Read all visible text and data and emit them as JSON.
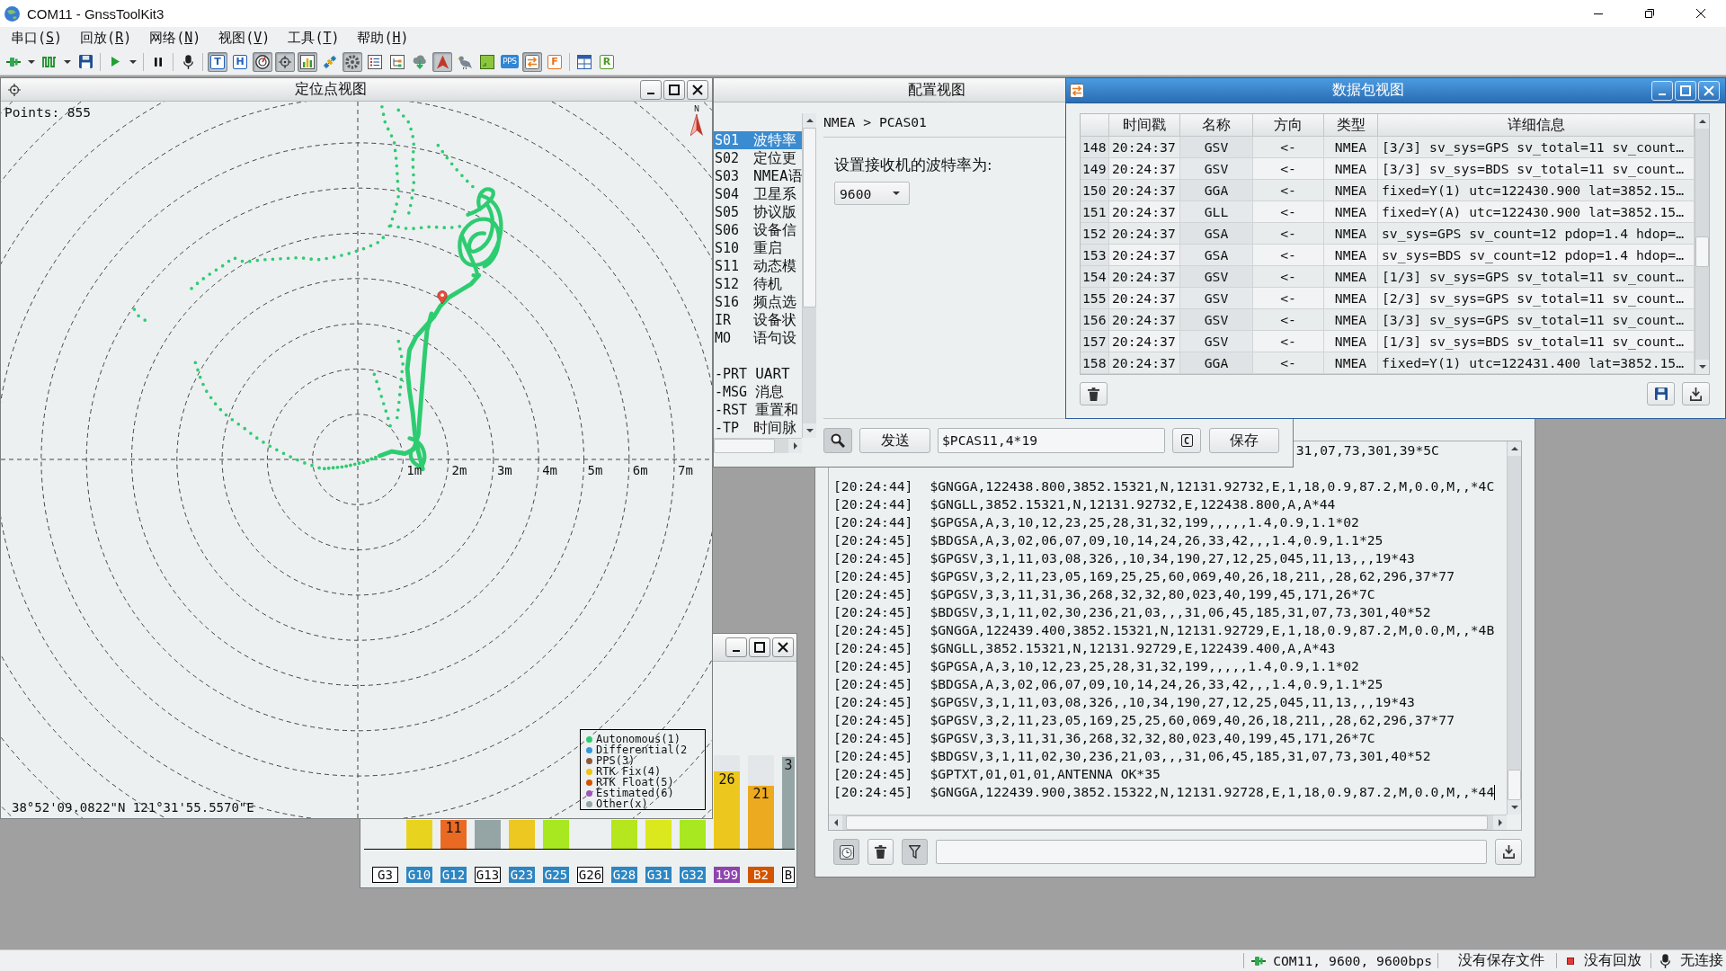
{
  "window": {
    "title": "COM11 - GnssToolKit3"
  },
  "menu": [
    {
      "before": "串口(",
      "key": "S",
      "after": ")"
    },
    {
      "before": "回放(",
      "key": "R",
      "after": ")"
    },
    {
      "before": "网络(",
      "key": "N",
      "after": ")"
    },
    {
      "before": "视图(",
      "key": "V",
      "after": ")"
    },
    {
      "before": "工具(",
      "key": "T",
      "after": ")"
    },
    {
      "before": "帮助(",
      "key": "H",
      "after": ")"
    }
  ],
  "toolbar": {
    "groups": [
      [
        {
          "kind": "plug",
          "dropdown": true
        },
        {
          "kind": "square-wave",
          "dropdown": true
        },
        {
          "kind": "save"
        }
      ],
      [
        {
          "kind": "play",
          "dropdown": true
        }
      ],
      [
        {
          "kind": "pause"
        }
      ],
      [
        {
          "kind": "microphone"
        }
      ],
      [
        {
          "kind": "letter-outline",
          "glyph": "T",
          "color": "#1f5fbf",
          "checked": true
        },
        {
          "kind": "letter-outline",
          "glyph": "H",
          "color": "#1f5fbf"
        },
        {
          "kind": "dial",
          "checked": true
        },
        {
          "kind": "crosshair",
          "checked": true
        },
        {
          "kind": "bar-chart",
          "checked": true
        },
        {
          "kind": "satellite"
        },
        {
          "kind": "gear",
          "checked": true
        },
        {
          "kind": "list"
        },
        {
          "kind": "tree"
        },
        {
          "kind": "cloud-download"
        },
        {
          "kind": "arrow",
          "checked": true
        },
        {
          "kind": "bird"
        },
        {
          "kind": "tile"
        },
        {
          "kind": "letter-filled",
          "glyph": "PPS",
          "color": "#2f86d6"
        },
        {
          "kind": "swap",
          "checked": true
        },
        {
          "kind": "letter-outline",
          "glyph": "F",
          "color": "#e8701a"
        }
      ],
      [
        {
          "kind": "layout"
        },
        {
          "kind": "letter-outline",
          "glyph": "R",
          "color": "#4e9a22"
        }
      ]
    ]
  },
  "position_view": {
    "title": "定位点视图",
    "points": "Points: 855",
    "coordinates": "38°52'09.0822\"N 121°31'55.5570\"E",
    "north_label": "N",
    "ring_labels": [
      "1m",
      "2m",
      "3m",
      "4m",
      "5m",
      "6m",
      "7m"
    ],
    "legend": [
      {
        "label": "Autonomous(1)",
        "color": "#2ecc71"
      },
      {
        "label": "Differential(2",
        "color": "#3498db"
      },
      {
        "label": "PPS(3)",
        "color": "#8e5a3c"
      },
      {
        "label": "RTK Fix(4)",
        "color": "#f1c40f"
      },
      {
        "label": "RTK Float(5)",
        "color": "#d35400"
      },
      {
        "label": "Estimated(6)",
        "color": "#9b59b6"
      },
      {
        "label": "Other(x)",
        "color": "#95a5a6"
      }
    ]
  },
  "config_view": {
    "title": "配置视图",
    "commands": [
      {
        "code": "S01",
        "name": "波特率",
        "selected": true
      },
      {
        "code": "S02",
        "name": "定位更",
        "selected": false
      },
      {
        "code": "S03",
        "name": "NMEA语",
        "selected": false
      },
      {
        "code": "S04",
        "name": "卫星系",
        "selected": false
      },
      {
        "code": "S05",
        "name": "协议版",
        "selected": false
      },
      {
        "code": "S06",
        "name": "设备信",
        "selected": false
      },
      {
        "code": "S10",
        "name": "重启",
        "selected": false
      },
      {
        "code": "S11",
        "name": "动态模",
        "selected": false
      },
      {
        "code": "S12",
        "name": "待机",
        "selected": false
      },
      {
        "code": "S16",
        "name": "频点选",
        "selected": false
      },
      {
        "code": "IR",
        "name": "设备状",
        "selected": false
      },
      {
        "code": "MO",
        "name": "语句设",
        "selected": false
      }
    ],
    "messages": [
      {
        "code": "-PRT",
        "name": "UART",
        "selected": false
      },
      {
        "code": "-MSG",
        "name": "消息",
        "selected": false
      },
      {
        "code": "-RST",
        "name": "重置和",
        "selected": false
      },
      {
        "code": "-TP",
        "name": "时间脉",
        "selected": false
      }
    ],
    "breadcrumb": "NMEA > PCAS01",
    "prompt": "设置接收机的波特率为:",
    "baud_rate": "9600",
    "search_checked": true,
    "send_label": "发送",
    "command": "$PCAS11,4*19",
    "clear_glyph": "C",
    "save_label": "保存"
  },
  "packet_view": {
    "title": "数据包视图",
    "columns": [
      "时间戳",
      "名称",
      "方向",
      "类型",
      "详细信息"
    ],
    "rows": [
      {
        "index": "148",
        "time": "20:24:37",
        "name": "GSV",
        "direction": "<-",
        "type": "NMEA",
        "detail": "[3/3] sv_sys=GPS sv_total=11 sv_count…"
      },
      {
        "index": "149",
        "time": "20:24:37",
        "name": "GSV",
        "direction": "<-",
        "type": "NMEA",
        "detail": "[3/3] sv_sys=BDS sv_total=11 sv_count…"
      },
      {
        "index": "150",
        "time": "20:24:37",
        "name": "GGA",
        "direction": "<-",
        "type": "NMEA",
        "detail": "fixed=Y(1) utc=122430.900 lat=3852.15…"
      },
      {
        "index": "151",
        "time": "20:24:37",
        "name": "GLL",
        "direction": "<-",
        "type": "NMEA",
        "detail": "fixed=Y(A) utc=122430.900 lat=3852.15…"
      },
      {
        "index": "152",
        "time": "20:24:37",
        "name": "GSA",
        "direction": "<-",
        "type": "NMEA",
        "detail": "sv_sys=GPS sv_count=12 pdop=1.4 hdop=…"
      },
      {
        "index": "153",
        "time": "20:24:37",
        "name": "GSA",
        "direction": "<-",
        "type": "NMEA",
        "detail": "sv_sys=BDS sv_count=12 pdop=1.4 hdop=…"
      },
      {
        "index": "154",
        "time": "20:24:37",
        "name": "GSV",
        "direction": "<-",
        "type": "NMEA",
        "detail": "[1/3] sv_sys=GPS sv_total=11 sv_count…"
      },
      {
        "index": "155",
        "time": "20:24:37",
        "name": "GSV",
        "direction": "<-",
        "type": "NMEA",
        "detail": "[2/3] sv_sys=GPS sv_total=11 sv_count…"
      },
      {
        "index": "156",
        "time": "20:24:37",
        "name": "GSV",
        "direction": "<-",
        "type": "NMEA",
        "detail": "[3/3] sv_sys=GPS sv_total=11 sv_count…"
      },
      {
        "index": "157",
        "time": "20:24:37",
        "name": "GSV",
        "direction": "<-",
        "type": "NMEA",
        "detail": "[1/3] sv_sys=BDS sv_total=11 sv_count…"
      },
      {
        "index": "158",
        "time": "20:24:37",
        "name": "GGA",
        "direction": "<-",
        "type": "NMEA",
        "detail": "fixed=Y(1) utc=122431.400 lat=3852.15…"
      }
    ]
  },
  "log_view": {
    "timestamp_checked": true,
    "filter_checked": true,
    "lines": [
      {
        "kind": "partial",
        "message": "31,07,73,301,39*5C"
      },
      {
        "kind": "entry",
        "time": "[20:24:44]",
        "message": "$GNGGA,122438.800,3852.15321,N,12131.92732,E,1,18,0.9,87.2,M,0.0,M,,*4C"
      },
      {
        "kind": "entry",
        "time": "[20:24:44]",
        "message": "$GNGLL,3852.15321,N,12131.92732,E,122438.800,A,A*44"
      },
      {
        "kind": "entry",
        "time": "[20:24:44]",
        "message": "$GPGSA,A,3,10,12,23,25,28,31,32,199,,,,,1.4,0.9,1.1*02"
      },
      {
        "kind": "entry",
        "time": "[20:24:45]",
        "message": "$BDGSA,A,3,02,06,07,09,10,14,24,26,33,42,,,1.4,0.9,1.1*25"
      },
      {
        "kind": "entry",
        "time": "[20:24:45]",
        "message": "$GPGSV,3,1,11,03,08,326,,10,34,190,27,12,25,045,11,13,,,19*43"
      },
      {
        "kind": "entry",
        "time": "[20:24:45]",
        "message": "$GPGSV,3,2,11,23,05,169,25,25,60,069,40,26,18,211,,28,62,296,37*77"
      },
      {
        "kind": "entry",
        "time": "[20:24:45]",
        "message": "$GPGSV,3,3,11,31,36,268,32,32,80,023,40,199,45,171,26*7C"
      },
      {
        "kind": "entry",
        "time": "[20:24:45]",
        "message": "$BDGSV,3,1,11,02,30,236,21,03,,,31,06,45,185,31,07,73,301,40*52"
      },
      {
        "kind": "entry",
        "time": "[20:24:45]",
        "message": "$GNGGA,122439.400,3852.15321,N,12131.92729,E,1,18,0.9,87.2,M,0.0,M,,*4B"
      },
      {
        "kind": "entry",
        "time": "[20:24:45]",
        "message": "$GNGLL,3852.15321,N,12131.92729,E,122439.400,A,A*43"
      },
      {
        "kind": "entry",
        "time": "[20:24:45]",
        "message": "$GPGSA,A,3,10,12,23,25,28,31,32,199,,,,,1.4,0.9,1.1*02"
      },
      {
        "kind": "entry",
        "time": "[20:24:45]",
        "message": "$BDGSA,A,3,02,06,07,09,10,14,24,26,33,42,,,1.4,0.9,1.1*25"
      },
      {
        "kind": "entry",
        "time": "[20:24:45]",
        "message": "$GPGSV,3,1,11,03,08,326,,10,34,190,27,12,25,045,11,13,,,19*43"
      },
      {
        "kind": "entry",
        "time": "[20:24:45]",
        "message": "$GPGSV,3,2,11,23,05,169,25,25,60,069,40,26,18,211,,28,62,296,37*77"
      },
      {
        "kind": "entry",
        "time": "[20:24:45]",
        "message": "$GPGSV,3,3,11,31,36,268,32,32,80,023,40,199,45,171,26*7C"
      },
      {
        "kind": "entry",
        "time": "[20:24:45]",
        "message": "$BDGSV,3,1,11,02,30,236,21,03,,,31,06,45,185,31,07,73,301,40*52"
      },
      {
        "kind": "entry",
        "time": "[20:24:45]",
        "message": "$GPTXT,01,01,01,ANTENNA OK*35"
      },
      {
        "kind": "entry",
        "time": "[20:24:45]",
        "message": "$GNGGA,122439.900,3852.15322,N,12131.92728,E,1,18,0.9,87.2,M,0.0,M,,*44"
      }
    ]
  },
  "satellite_view": {
    "satellites": [
      {
        "label": "G3",
        "in_use": false
      },
      {
        "label": "G10",
        "in_use": true,
        "color": "#2e86c1",
        "bar": {
          "kind": "clipped",
          "color": "#e8d41e"
        }
      },
      {
        "label": "G12",
        "in_use": true,
        "color": "#2e86c1",
        "bar": {
          "kind": "clipped",
          "color": "#ea6a24",
          "value": "11"
        }
      },
      {
        "label": "G13",
        "in_use": false,
        "bar": {
          "kind": "clipped",
          "color": "#95a5a6"
        }
      },
      {
        "label": "G23",
        "in_use": true,
        "color": "#2e86c1",
        "bar": {
          "kind": "clipped",
          "color": "#ecc820"
        }
      },
      {
        "label": "G25",
        "in_use": true,
        "color": "#2e86c1",
        "bar": {
          "kind": "clipped",
          "color": "#a8e820"
        }
      },
      {
        "label": "G26",
        "in_use": false
      },
      {
        "label": "G28",
        "in_use": true,
        "color": "#2e86c1",
        "bar": {
          "kind": "clipped",
          "color": "#b6e61e"
        }
      },
      {
        "label": "G31",
        "in_use": true,
        "color": "#2e86c1",
        "bar": {
          "kind": "clipped",
          "color": "#dce81e"
        }
      },
      {
        "label": "G32",
        "in_use": true,
        "color": "#2e86c1",
        "bar": {
          "kind": "clipped",
          "color": "#a8e820"
        }
      },
      {
        "label": "199",
        "in_use": true,
        "color": "#8e44ad",
        "bar": {
          "kind": "full",
          "level": 0.827,
          "color": "#ecc81e",
          "value": "26"
        }
      },
      {
        "label": "B2",
        "in_use": true,
        "color": "#d35400",
        "bar": {
          "kind": "full",
          "level": 0.673,
          "color": "#ecaa20",
          "value": "21"
        }
      },
      {
        "label": "B",
        "in_use": false,
        "bar": {
          "kind": "full",
          "level": 0.981,
          "color": "#95a5a6",
          "value": "3"
        }
      }
    ]
  },
  "status_bar": {
    "port": "COM11, 9600, 9600bps",
    "save_status": "没有保存文件",
    "playback": "没有回放",
    "connection": "无连接"
  }
}
